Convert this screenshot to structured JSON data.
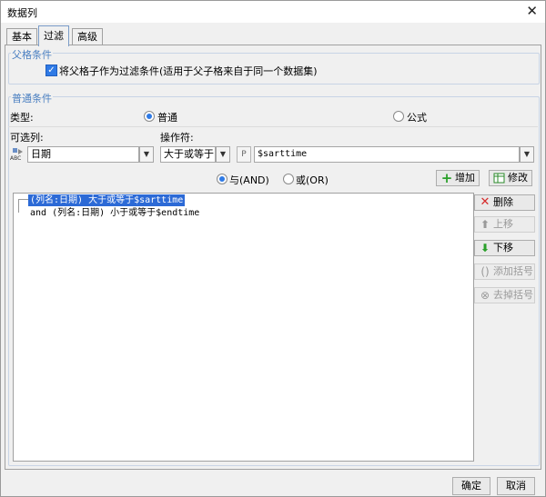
{
  "window": {
    "title": "数据列",
    "close_glyph": "✕"
  },
  "tabs": [
    {
      "label": "基本"
    },
    {
      "label": "过滤"
    },
    {
      "label": "高级"
    }
  ],
  "parent_condition": {
    "title": "父格条件",
    "checkbox_label": "将父格子作为过滤条件(适用于父子格来自于同一个数据集)",
    "checked": true
  },
  "normal_condition": {
    "title": "普通条件",
    "type_label": "类型:",
    "type_options": [
      "普通",
      "公式"
    ],
    "type_selected": "普通",
    "column_label": "可选列:",
    "column_value": "日期",
    "operator_label": "操作符:",
    "operator_value": "大于或等于",
    "param_value": "$sarttime",
    "logic_options": [
      "与(AND)",
      "或(OR)"
    ],
    "logic_selected": "与(AND)",
    "add_button": "增加",
    "modify_button": "修改"
  },
  "conditions": [
    "(列名:日期) 大于或等于$sarttime",
    "and (列名:日期) 小于或等于$endtime"
  ],
  "side_buttons": {
    "delete": "删除",
    "up": "上移",
    "down": "下移",
    "add_bracket": "添加括号",
    "remove_bracket": "去掉括号"
  },
  "footer": {
    "ok": "确定",
    "cancel": "取消"
  },
  "colors": {
    "accent": "#2f7ae5",
    "group_title": "#4a7fc1",
    "add_green": "#2aa02a",
    "delete_red": "#d62b2b"
  }
}
